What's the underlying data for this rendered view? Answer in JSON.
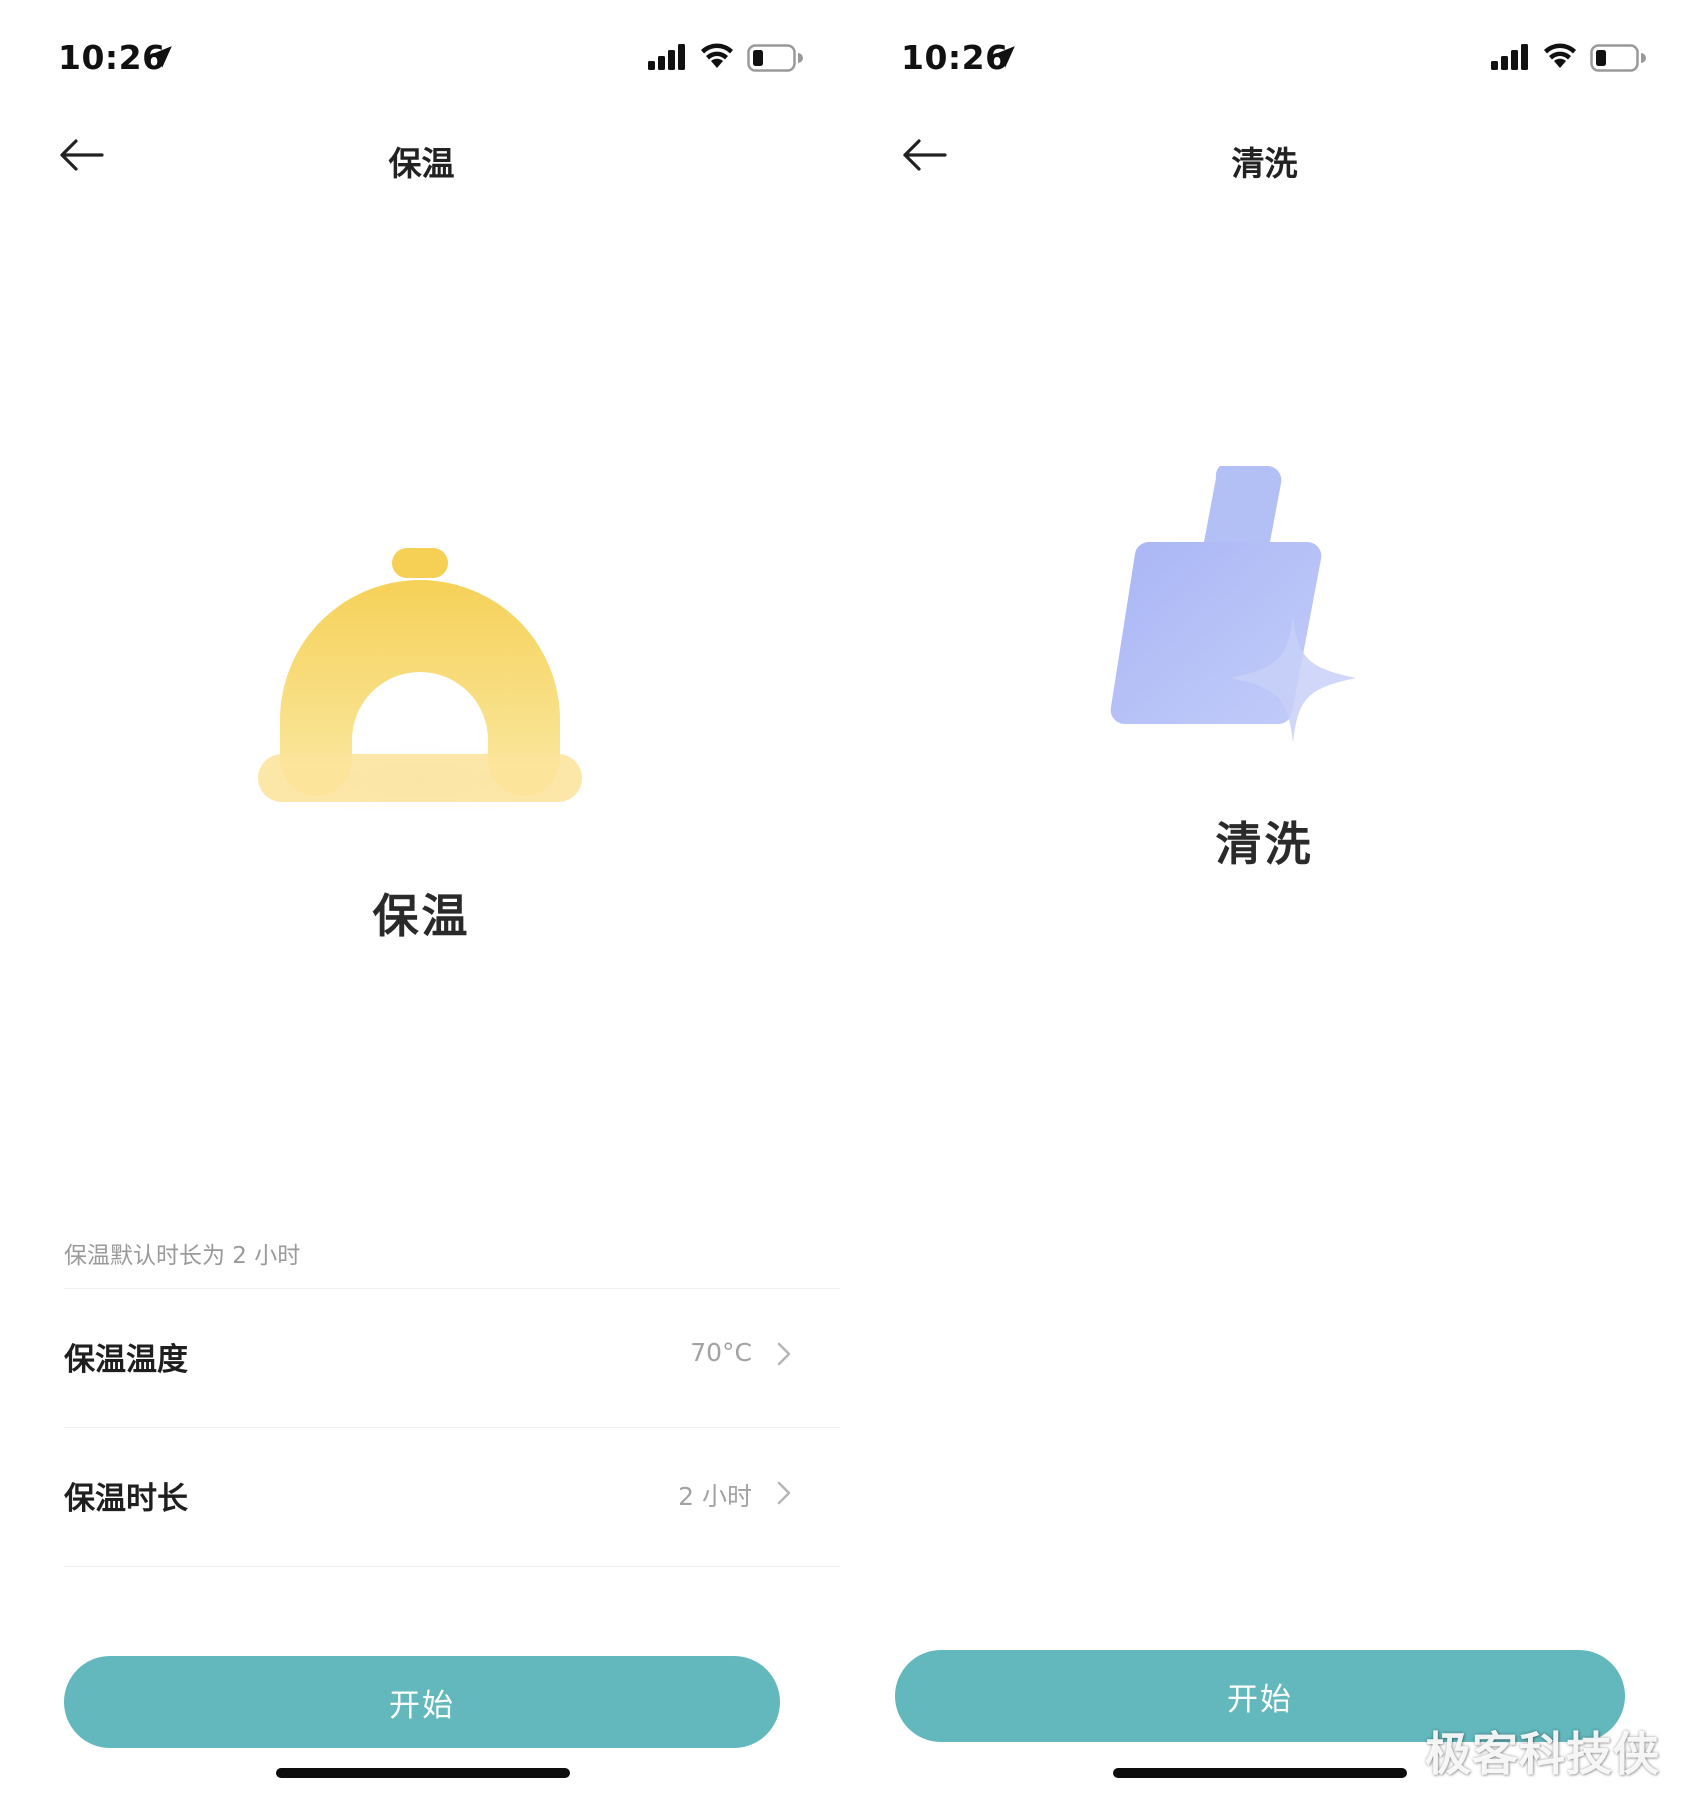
{
  "left_screen": {
    "status_bar": {
      "time": "10:26"
    },
    "nav": {
      "title": "保温"
    },
    "mode_title": "保温",
    "hint": "保温默认时长为 2 小时",
    "settings": [
      {
        "label": "保温温度",
        "value": "70°C"
      },
      {
        "label": "保温时长",
        "value": "2 小时"
      }
    ],
    "start_label": "开始",
    "colors": {
      "accent": "#62b8bd",
      "illustration": "#f5d35f"
    }
  },
  "right_screen": {
    "status_bar": {
      "time": "10:26"
    },
    "nav": {
      "title": "清洗"
    },
    "mode_title": "清洗",
    "start_label": "开始",
    "colors": {
      "accent": "#62b8bd",
      "illustration": "#aebcf6"
    }
  },
  "watermark": "极客科技侠",
  "icons": [
    "location-arrow-icon",
    "cellular-signal-icon",
    "wifi-icon",
    "battery-icon",
    "back-arrow-icon",
    "chevron-right-icon",
    "keep-warm-dome-icon",
    "cleaning-brush-icon"
  ]
}
